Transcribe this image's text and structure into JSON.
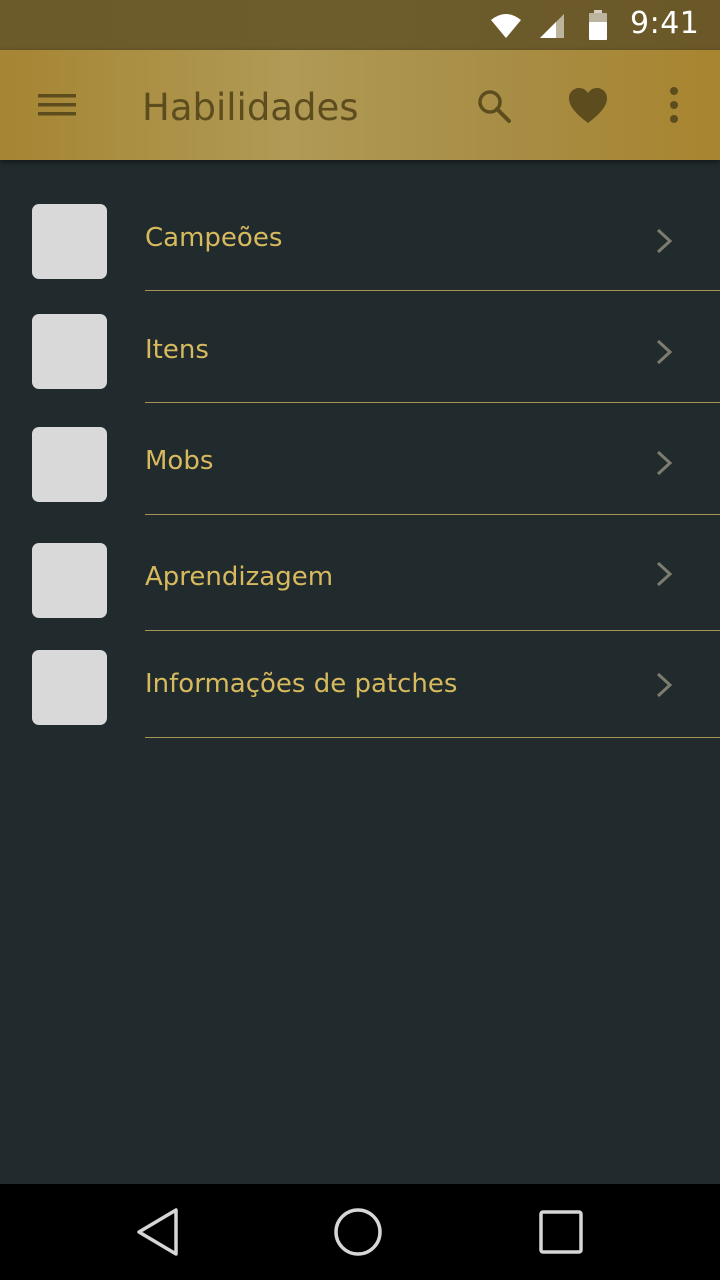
{
  "status_bar": {
    "time": "9:41",
    "icons": [
      "wifi-icon",
      "signal-icon",
      "battery-icon"
    ]
  },
  "app_bar": {
    "title": "Habilidades",
    "actions": [
      "menu-icon",
      "search-icon",
      "heart-icon",
      "more-vert-icon"
    ]
  },
  "list": {
    "items": [
      {
        "label": "Campeões"
      },
      {
        "label": "Itens"
      },
      {
        "label": "Mobs"
      },
      {
        "label": "Aprendizagem"
      },
      {
        "label": "Informações de patches"
      }
    ]
  },
  "nav_bar": {
    "buttons": [
      "back-icon",
      "home-icon",
      "recents-icon"
    ]
  },
  "colors": {
    "background": "#212b2d",
    "app_bar": "#b09a55",
    "accent_text": "#d7b95e",
    "title_text": "#5d4c1e",
    "divider": "#a69552",
    "thumbnail": "#d9d9d9"
  }
}
